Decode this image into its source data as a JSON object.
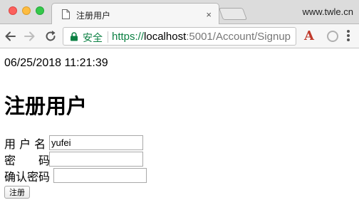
{
  "browser": {
    "tab_title": "注册用户",
    "tab_close": "×",
    "profile_name": "www.twle.cn",
    "security_label": "安全",
    "url": {
      "scheme": "https://",
      "host": "localhost",
      "path": ":5001/Account/Signup"
    },
    "icons": {
      "back": "arrow-left-icon",
      "forward": "arrow-right-icon",
      "reload": "reload-icon",
      "lock": "lock-icon",
      "extension_a": "A",
      "menu": "kebab-menu-icon"
    }
  },
  "page": {
    "timestamp": "06/25/2018 11:21:39",
    "heading": "注册用户",
    "form": {
      "username_label": "用 户 名",
      "username_value": "yufei",
      "password_label": "密　　码",
      "password_value": "",
      "confirm_label": "确认密码",
      "confirm_value": "",
      "submit_label": "注册"
    }
  },
  "colors": {
    "secure_green": "#0b8043",
    "extension_red": "#c0392b",
    "traffic_red": "#fc605c",
    "traffic_yellow": "#fdbc40",
    "traffic_green": "#34c84a"
  }
}
